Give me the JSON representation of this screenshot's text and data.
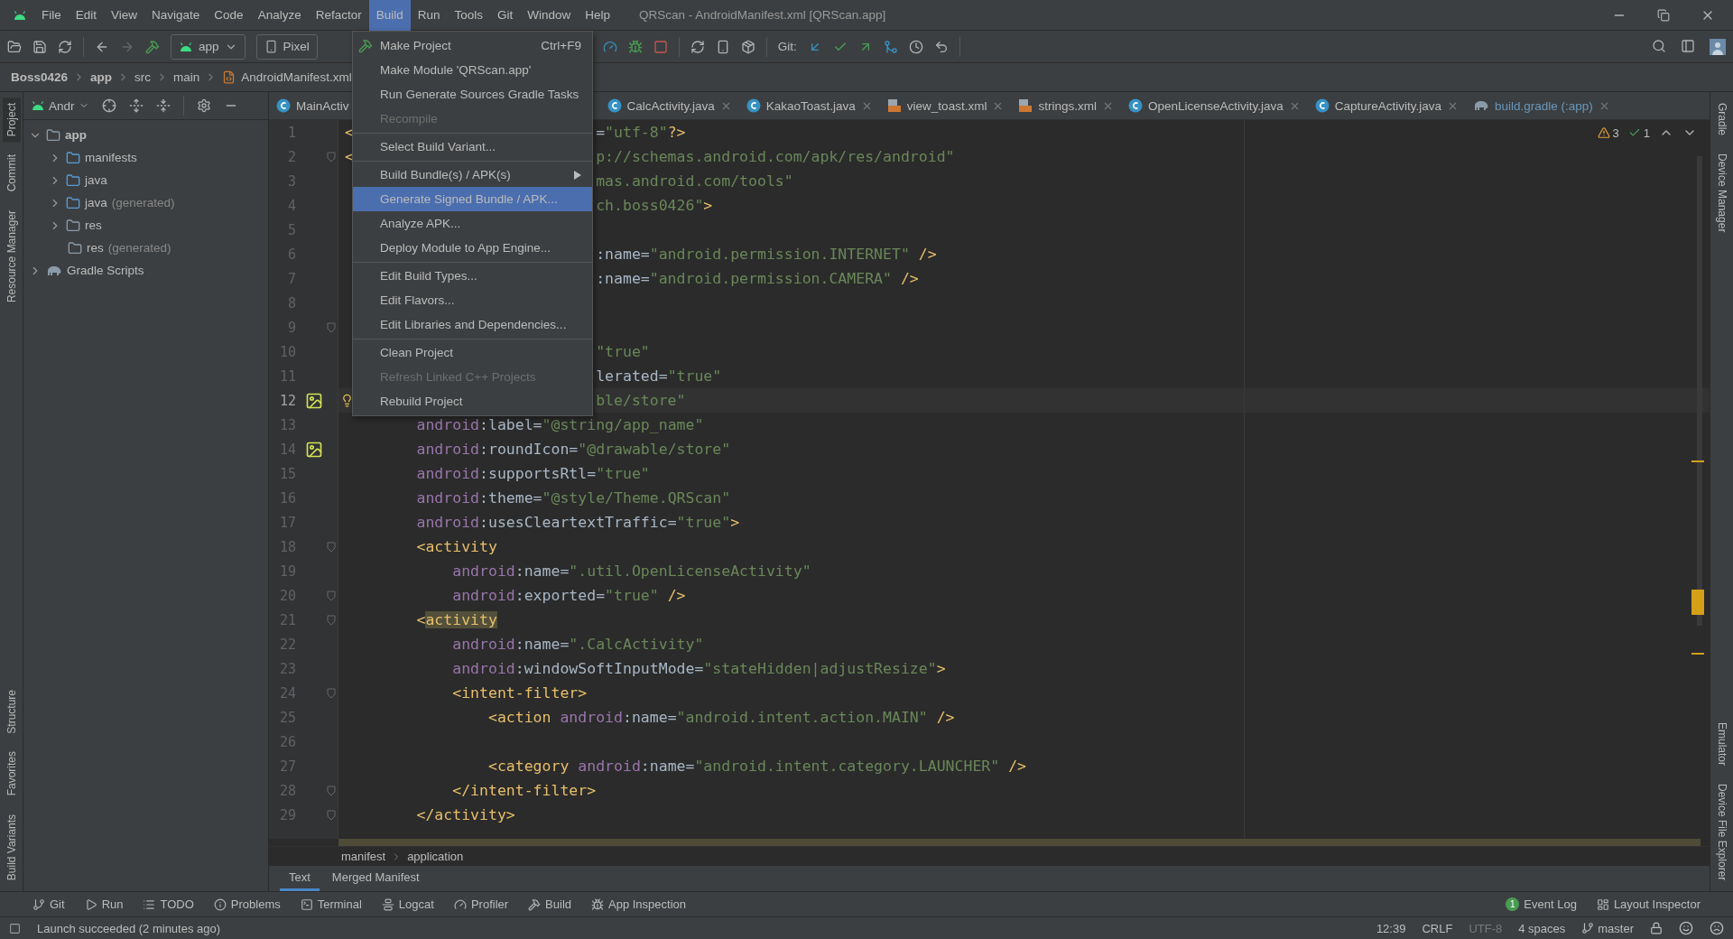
{
  "title_bar": {
    "menus": [
      {
        "label": "File",
        "selected": false
      },
      {
        "label": "Edit",
        "selected": false
      },
      {
        "label": "View",
        "selected": false
      },
      {
        "label": "Navigate",
        "selected": false
      },
      {
        "label": "Code",
        "selected": false
      },
      {
        "label": "Analyze",
        "selected": false
      },
      {
        "label": "Refactor",
        "selected": false
      },
      {
        "label": "Build",
        "selected": true
      },
      {
        "label": "Run",
        "selected": false
      },
      {
        "label": "Tools",
        "selected": false
      },
      {
        "label": "Git",
        "selected": false
      },
      {
        "label": "Window",
        "selected": false
      },
      {
        "label": "Help",
        "selected": false
      }
    ],
    "title": "QRScan - AndroidManifest.xml [QRScan.app]"
  },
  "toolbar": {
    "run_config": "app",
    "device": "Pixel",
    "git_label": "Git:"
  },
  "breadcrumb": [
    "Boss0426",
    "app",
    "src",
    "main",
    "AndroidManifest.xml"
  ],
  "left_stripe": {
    "top": [
      {
        "label": "Project",
        "selected": true
      },
      {
        "label": "Commit",
        "selected": false
      },
      {
        "label": "Resource Manager",
        "selected": false
      }
    ],
    "bottom": [
      {
        "label": "Structure",
        "selected": false
      },
      {
        "label": "Favorites",
        "selected": false
      },
      {
        "label": "Build Variants",
        "selected": false
      }
    ]
  },
  "project": {
    "view": "Andr",
    "tree": [
      {
        "name": "app",
        "kind": "module",
        "expanded": true,
        "children": [
          {
            "name": "manifests",
            "kind": "folder",
            "expanded": false
          },
          {
            "name": "java",
            "kind": "folder",
            "expanded": false
          },
          {
            "name": "java",
            "note": "(generated)",
            "kind": "generated",
            "expanded": false
          },
          {
            "name": "res",
            "kind": "res",
            "expanded": false
          },
          {
            "name": "res",
            "note": "(generated)",
            "kind": "res",
            "expanded": false
          }
        ]
      },
      {
        "name": "Gradle Scripts",
        "kind": "gradle",
        "expanded": false
      }
    ]
  },
  "editor_tabs": {
    "partial": {
      "label": "MainActiv",
      "kind": "class"
    },
    "tabs": [
      {
        "label": "CalcActivity.java",
        "kind": "class",
        "modified": false
      },
      {
        "label": "KakaoToast.java",
        "kind": "class",
        "modified": false
      },
      {
        "label": "view_toast.xml",
        "kind": "xml",
        "modified": false
      },
      {
        "label": "strings.xml",
        "kind": "xml",
        "modified": false
      },
      {
        "label": "OpenLicenseActivity.java",
        "kind": "class",
        "modified": false
      },
      {
        "label": "CaptureActivity.java",
        "kind": "class",
        "modified": false
      },
      {
        "label": "build.gradle (:app)",
        "kind": "gradle",
        "modified": true
      }
    ]
  },
  "inspections": {
    "warnings": "3",
    "passed": "1"
  },
  "code": {
    "lines": [
      {
        "num": "1",
        "current": false,
        "fold": false,
        "image": false,
        "left": "<",
        "tail": [
          {
            "kind": "plain",
            "text": "="
          },
          {
            "kind": "str",
            "text": "\"utf-8\""
          },
          {
            "kind": "tag",
            "text": "?>"
          }
        ]
      },
      {
        "num": "2",
        "current": false,
        "fold": true,
        "image": false,
        "left": "<",
        "tail": [
          {
            "kind": "str",
            "text": "p://schemas.android.com/apk/res/android\""
          }
        ]
      },
      {
        "num": "3",
        "current": false,
        "fold": false,
        "image": false,
        "tail": [
          {
            "kind": "str",
            "text": "mas.android.com/tools\""
          }
        ]
      },
      {
        "num": "4",
        "current": false,
        "fold": false,
        "image": false,
        "tail": [
          {
            "kind": "str",
            "text": "ch.boss0426\""
          },
          {
            "kind": "tag",
            "text": ">"
          }
        ]
      },
      {
        "num": "5",
        "current": false,
        "fold": false,
        "image": false
      },
      {
        "num": "6",
        "current": false,
        "fold": false,
        "image": false,
        "tail": [
          {
            "kind": "plain",
            "text": ":name="
          },
          {
            "kind": "str",
            "text": "\"android.permission.INTERNET\""
          },
          {
            "kind": "tag",
            "text": " />"
          }
        ]
      },
      {
        "num": "7",
        "current": false,
        "fold": false,
        "image": false,
        "tail": [
          {
            "kind": "plain",
            "text": ":name="
          },
          {
            "kind": "str",
            "text": "\"android.permission.CAMERA\""
          },
          {
            "kind": "tag",
            "text": " />"
          }
        ]
      },
      {
        "num": "8",
        "current": false,
        "fold": false,
        "image": false
      },
      {
        "num": "9",
        "current": false,
        "fold": true,
        "image": false
      },
      {
        "num": "10",
        "current": false,
        "fold": false,
        "image": false,
        "tail": [
          {
            "kind": "str",
            "text": "\"true\""
          }
        ]
      },
      {
        "num": "11",
        "current": false,
        "fold": false,
        "image": false,
        "tail": [
          {
            "kind": "plain",
            "text": "lerated="
          },
          {
            "kind": "str",
            "text": "\"true\""
          }
        ]
      },
      {
        "num": "12",
        "current": true,
        "fold": false,
        "image": true,
        "bulb": true,
        "tail": [
          {
            "kind": "str",
            "text": "ble/store\""
          }
        ]
      },
      {
        "num": "13",
        "current": false,
        "fold": false,
        "image": false,
        "tokens": [
          {
            "kind": "ns",
            "text": "        android"
          },
          {
            "kind": "plain",
            "text": ":label="
          },
          {
            "kind": "str",
            "text": "\"@string/app_name\""
          }
        ]
      },
      {
        "num": "14",
        "current": false,
        "fold": false,
        "image": true,
        "tokens": [
          {
            "kind": "ns",
            "text": "        android"
          },
          {
            "kind": "plain",
            "text": ":roundIcon="
          },
          {
            "kind": "str",
            "text": "\"@drawable/store\""
          }
        ]
      },
      {
        "num": "15",
        "current": false,
        "fold": false,
        "image": false,
        "tokens": [
          {
            "kind": "ns",
            "text": "        android"
          },
          {
            "kind": "plain",
            "text": ":supportsRtl="
          },
          {
            "kind": "str",
            "text": "\"true\""
          }
        ]
      },
      {
        "num": "16",
        "current": false,
        "fold": false,
        "image": false,
        "tokens": [
          {
            "kind": "ns",
            "text": "        android"
          },
          {
            "kind": "plain",
            "text": ":theme="
          },
          {
            "kind": "str",
            "text": "\"@style/Theme.QRScan\""
          }
        ]
      },
      {
        "num": "17",
        "current": false,
        "fold": false,
        "image": false,
        "tokens": [
          {
            "kind": "ns",
            "text": "        android"
          },
          {
            "kind": "plain",
            "text": ":usesCleartextTraffic="
          },
          {
            "kind": "str",
            "text": "\"true\""
          },
          {
            "kind": "tag",
            "text": ">"
          }
        ]
      },
      {
        "num": "18",
        "current": false,
        "fold": true,
        "image": false,
        "tokens": [
          {
            "kind": "tag",
            "text": "        <activity"
          }
        ]
      },
      {
        "num": "19",
        "current": false,
        "fold": false,
        "image": false,
        "tokens": [
          {
            "kind": "ns",
            "text": "            android"
          },
          {
            "kind": "plain",
            "text": ":name="
          },
          {
            "kind": "str",
            "text": "\".util.OpenLicenseActivity\""
          }
        ]
      },
      {
        "num": "20",
        "current": false,
        "fold": true,
        "image": false,
        "tokens": [
          {
            "kind": "ns",
            "text": "            android"
          },
          {
            "kind": "plain",
            "text": ":exported="
          },
          {
            "kind": "str",
            "text": "\"true\""
          },
          {
            "kind": "tag",
            "text": " />"
          }
        ]
      },
      {
        "num": "21",
        "current": false,
        "fold": true,
        "image": false,
        "tokens": [
          {
            "kind": "tag",
            "text": "        <"
          },
          {
            "kind": "tag_hl",
            "text": "activity"
          }
        ]
      },
      {
        "num": "22",
        "current": false,
        "fold": false,
        "image": false,
        "tokens": [
          {
            "kind": "ns",
            "text": "            android"
          },
          {
            "kind": "plain",
            "text": ":name="
          },
          {
            "kind": "str",
            "text": "\".CalcActivity\""
          }
        ]
      },
      {
        "num": "23",
        "current": false,
        "fold": false,
        "image": false,
        "tokens": [
          {
            "kind": "ns",
            "text": "            android"
          },
          {
            "kind": "plain",
            "text": ":windowSoftInputMode="
          },
          {
            "kind": "str",
            "text": "\"stateHidden|adjustResize\""
          },
          {
            "kind": "tag",
            "text": ">"
          }
        ]
      },
      {
        "num": "24",
        "current": false,
        "fold": true,
        "image": false,
        "tokens": [
          {
            "kind": "tag",
            "text": "            <intent-filter>"
          }
        ]
      },
      {
        "num": "25",
        "current": false,
        "fold": false,
        "image": false,
        "tokens": [
          {
            "kind": "tag",
            "text": "                <action "
          },
          {
            "kind": "ns",
            "text": "android"
          },
          {
            "kind": "plain",
            "text": ":name="
          },
          {
            "kind": "str",
            "text": "\"android.intent.action.MAIN\""
          },
          {
            "kind": "tag",
            "text": " />"
          }
        ]
      },
      {
        "num": "26",
        "current": false,
        "fold": false,
        "image": false
      },
      {
        "num": "27",
        "current": false,
        "fold": false,
        "image": false,
        "tokens": [
          {
            "kind": "tag",
            "text": "                <category "
          },
          {
            "kind": "ns",
            "text": "android"
          },
          {
            "kind": "plain",
            "text": ":name="
          },
          {
            "kind": "str",
            "text": "\"android.intent.category.LAUNCHER\""
          },
          {
            "kind": "tag",
            "text": " />"
          }
        ]
      },
      {
        "num": "28",
        "current": false,
        "fold": true,
        "image": false,
        "tokens": [
          {
            "kind": "tag",
            "text": "            </intent-filter>"
          }
        ]
      },
      {
        "num": "29",
        "current": false,
        "fold": true,
        "image": false,
        "tokens": [
          {
            "kind": "tag",
            "text": "        </activity>"
          }
        ]
      }
    ]
  },
  "build_menu": {
    "items": [
      {
        "kind": "item",
        "label": "Make Project",
        "shortcut": "Ctrl+F9",
        "icon": true,
        "disabled": false,
        "selected": false
      },
      {
        "kind": "item",
        "label": "Make Module 'QRScan.app'",
        "disabled": false,
        "selected": false
      },
      {
        "kind": "item",
        "label": "Run Generate Sources Gradle Tasks",
        "disabled": false,
        "selected": false
      },
      {
        "kind": "item",
        "label": "Recompile",
        "disabled": true,
        "selected": false
      },
      {
        "kind": "separator"
      },
      {
        "kind": "item",
        "label": "Select Build Variant...",
        "disabled": false,
        "selected": false
      },
      {
        "kind": "separator"
      },
      {
        "kind": "item",
        "label": "Build Bundle(s) / APK(s)",
        "disabled": false,
        "selected": false,
        "submenu": true
      },
      {
        "kind": "item",
        "label": "Generate Signed Bundle / APK...",
        "disabled": false,
        "selected": true
      },
      {
        "kind": "item",
        "label": "Analyze APK...",
        "disabled": false,
        "selected": false
      },
      {
        "kind": "item",
        "label": "Deploy Module to App Engine...",
        "disabled": false,
        "selected": false
      },
      {
        "kind": "separator"
      },
      {
        "kind": "item",
        "label": "Edit Build Types...",
        "disabled": false,
        "selected": false
      },
      {
        "kind": "item",
        "label": "Edit Flavors...",
        "disabled": false,
        "selected": false
      },
      {
        "kind": "item",
        "label": "Edit Libraries and Dependencies...",
        "disabled": false,
        "selected": false
      },
      {
        "kind": "separator"
      },
      {
        "kind": "item",
        "label": "Clean Project",
        "disabled": false,
        "selected": false
      },
      {
        "kind": "item",
        "label": "Refresh Linked C++ Projects",
        "disabled": true,
        "selected": false
      },
      {
        "kind": "item",
        "label": "Rebuild Project",
        "disabled": false,
        "selected": false
      }
    ]
  },
  "editor_footer": {
    "path": [
      "manifest",
      "application"
    ],
    "tabs": [
      {
        "label": "Text",
        "selected": true
      },
      {
        "label": "Merged Manifest",
        "selected": false
      }
    ]
  },
  "right_stripe": {
    "top": [
      "Gradle",
      "Device Manager"
    ],
    "bottom": [
      "Emulator",
      "Device File Explorer"
    ]
  },
  "tool_windows": {
    "left": [
      {
        "label": "Git",
        "kind": "git"
      },
      {
        "label": "Run",
        "kind": "run"
      },
      {
        "label": "TODO",
        "kind": "todo"
      },
      {
        "label": "Problems",
        "kind": "problems"
      },
      {
        "label": "Terminal",
        "kind": "terminal"
      },
      {
        "label": "Logcat",
        "kind": "logcat"
      },
      {
        "label": "Profiler",
        "kind": "profiler"
      },
      {
        "label": "Build",
        "kind": "build"
      },
      {
        "label": "App Inspection",
        "kind": "inspection"
      }
    ],
    "right": [
      {
        "label": "Event Log",
        "kind": "events",
        "badge": "1"
      },
      {
        "label": "Layout Inspector",
        "kind": "layout"
      }
    ]
  },
  "status": {
    "message": "Launch succeeded (2 minutes ago)",
    "items": [
      {
        "label": "12:39",
        "kind": "text"
      },
      {
        "label": "CRLF",
        "kind": "text"
      },
      {
        "label": "UTF-8",
        "kind": "dim"
      },
      {
        "label": "4 spaces",
        "kind": "text"
      },
      {
        "label": "master",
        "kind": "branch"
      }
    ]
  }
}
